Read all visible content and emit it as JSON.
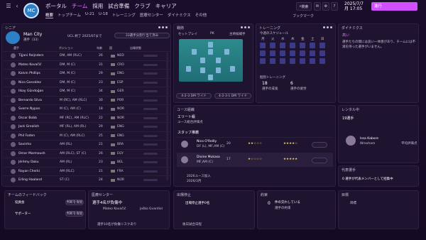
{
  "nav": {
    "items": [
      "ポータル",
      "チーム",
      "採用",
      "試合準備",
      "クラブ",
      "キャリア"
    ],
    "active": 1,
    "sub": [
      "概要",
      "トップチーム",
      "U-21",
      "U-18",
      "トレーニング",
      "医療センター",
      "ダイナミクス",
      "その他"
    ],
    "sub_active": 0
  },
  "top": {
    "search": "検索",
    "date_line1": "2025/7/7",
    "date_line2": "月 17:05",
    "continue": "進行",
    "bookmark": "ブックマーク"
  },
  "squad": {
    "title": "シニア",
    "club": "Man City",
    "subtitle": "選手（33）",
    "competition": "UCL 終了 2025/07まで",
    "action": "33選手分割り当て済み",
    "headers": [
      "選手",
      "ポジション",
      "年齢",
      "国",
      "出場状態"
    ],
    "rows": [
      {
        "name": "Tijjani Reijnders",
        "pos": "DM, AM (RLC)",
        "age": "26",
        "nat": "NED"
      },
      {
        "name": "Mateo Kovačić",
        "pos": "DM, M (C)",
        "age": "31",
        "nat": "CRO"
      },
      {
        "name": "Kalvin Phillips",
        "pos": "DM, M (C)",
        "age": "29",
        "nat": "ENG"
      },
      {
        "name": "Nico González",
        "pos": "DM, M (C)",
        "age": "23",
        "nat": "ESP"
      },
      {
        "name": "Ilkay Gündoğan",
        "pos": "DM, M (C)",
        "age": "34",
        "nat": "GER"
      },
      {
        "name": "Bernardo Silva",
        "pos": "M (RC), AM (RLC)",
        "age": "30",
        "nat": "POR"
      },
      {
        "name": "Sverre Nypan",
        "pos": "M (C), AM (C)",
        "age": "18",
        "nat": "NOR"
      },
      {
        "name": "Oscar Bobb",
        "pos": "MF (RC), AM (RLC)",
        "age": "22",
        "nat": "NOR"
      },
      {
        "name": "Jack Grealish",
        "pos": "MF (RL), AM (RL)",
        "age": "29",
        "nat": "ENG"
      },
      {
        "name": "Phil Foden",
        "pos": "M (C), AM (RLC)",
        "age": "25",
        "nat": "ENG"
      },
      {
        "name": "Savinho",
        "pos": "AM (RL)",
        "age": "21",
        "nat": "BRA"
      },
      {
        "name": "Omar Marmoush",
        "pos": "AM (RLC), ST (C)",
        "age": "26",
        "nat": "EGY"
      },
      {
        "name": "Jérémy Doku",
        "pos": "AM (RL)",
        "age": "23",
        "nat": "BEL"
      },
      {
        "name": "Rayan Cherki",
        "pos": "AM (RLC)",
        "age": "21",
        "nat": "FRA"
      },
      {
        "name": "Erling Haaland",
        "pos": "ST (C)",
        "age": "24",
        "nat": "NOR"
      }
    ]
  },
  "tactics": {
    "title": "戦術",
    "setplay": "セットプレイ",
    "pk": "PK",
    "captain": "主将候補手",
    "formation1": "4-2-3 DM ワイド",
    "formation2": "4-2-3-1 DM ワイド"
  },
  "training": {
    "title": "トレーニング",
    "schedule": "今週のスケジュール",
    "days": [
      "月",
      "火",
      "水",
      "木",
      "金",
      "土",
      "日"
    ],
    "indiv": "個別トレーニング",
    "count1": "18",
    "count2": "6",
    "c1": "選手の成長",
    "c2": "選手の疲労"
  },
  "dynamics": {
    "title": "ダイナミクス",
    "level": "高い",
    "text": "選手たちの間には良い一体感があり、チームには不満を持った選手がいません。"
  },
  "youth": {
    "title": "ユース組織",
    "rating": "エリート級",
    "sub": "ユース総合評価点",
    "staff": "スタッフ推薦",
    "recs": [
      {
        "name": "Nico O'Reilly",
        "pos": "DF (L), MF,AM (C)",
        "age": "20"
      },
      {
        "name": "Divine Mukasa",
        "pos": "MF,AM (C)",
        "age": "17"
      }
    ],
    "intake": "2026ユース加入",
    "intake_date": "2026/3月"
  },
  "loans": {
    "title": "レンタル中",
    "count": "19選手",
    "player": "Issa Kabore",
    "club": "Wrexham",
    "stat": "平均評価点"
  },
  "intl": {
    "title": "代表選手",
    "text": "0 選手が代表メンバーとして招集中"
  },
  "feedback": {
    "title": "チームのフィードバック",
    "r1": "役員会",
    "r2": "サポーター",
    "b1": "判断を保留",
    "b2": "判断を保留"
  },
  "medical": {
    "title": "医療センター",
    "text": "選手4名が負傷中",
    "p1": "Mateo Kovačić",
    "p2": "Joško Gvardiol",
    "foot": "選手10名が負傷リスクあり"
  },
  "suspension": {
    "title": "出場停止",
    "text": "出場停止選手0名",
    "foot": "後日試合日程"
  },
  "contracts": {
    "title": "約束",
    "text": "件の交わしている",
    "sub": "選手の約束",
    "num": "0"
  },
  "goals": {
    "title": "目標",
    "text": "目標"
  }
}
